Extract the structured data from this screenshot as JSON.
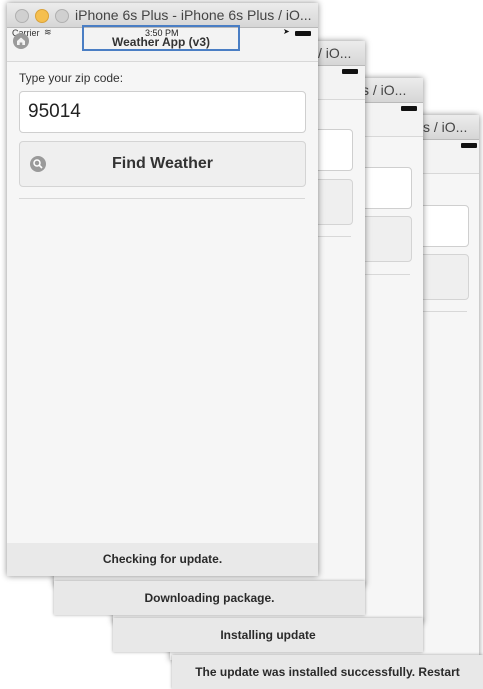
{
  "window": {
    "title": "iPhone 6s Plus - iPhone 6s Plus / iO...",
    "title_peek": "/ iO...",
    "title_peek2": "s / iO...",
    "title_peek3": "s / iO..."
  },
  "statusbar": {
    "carrier": "Carrier",
    "wifi_icon": "≋",
    "time": "3:50 PM",
    "location_icon": "➤",
    "app_title": "Weather App (v3)"
  },
  "form": {
    "zip_label": "Type your zip code:",
    "zip_value": "95014",
    "find_button_label": "Find Weather"
  },
  "toasts": {
    "checking": "Checking for update.",
    "downloading": "Downloading package.",
    "installing": "Installing update",
    "installed": "The update was installed successfully. Restart"
  },
  "colors": {
    "highlight_border": "#4a7ec4",
    "close": "#ed6a5e",
    "minimize": "#f5bf4f",
    "zoom": "#c8c8c8"
  }
}
